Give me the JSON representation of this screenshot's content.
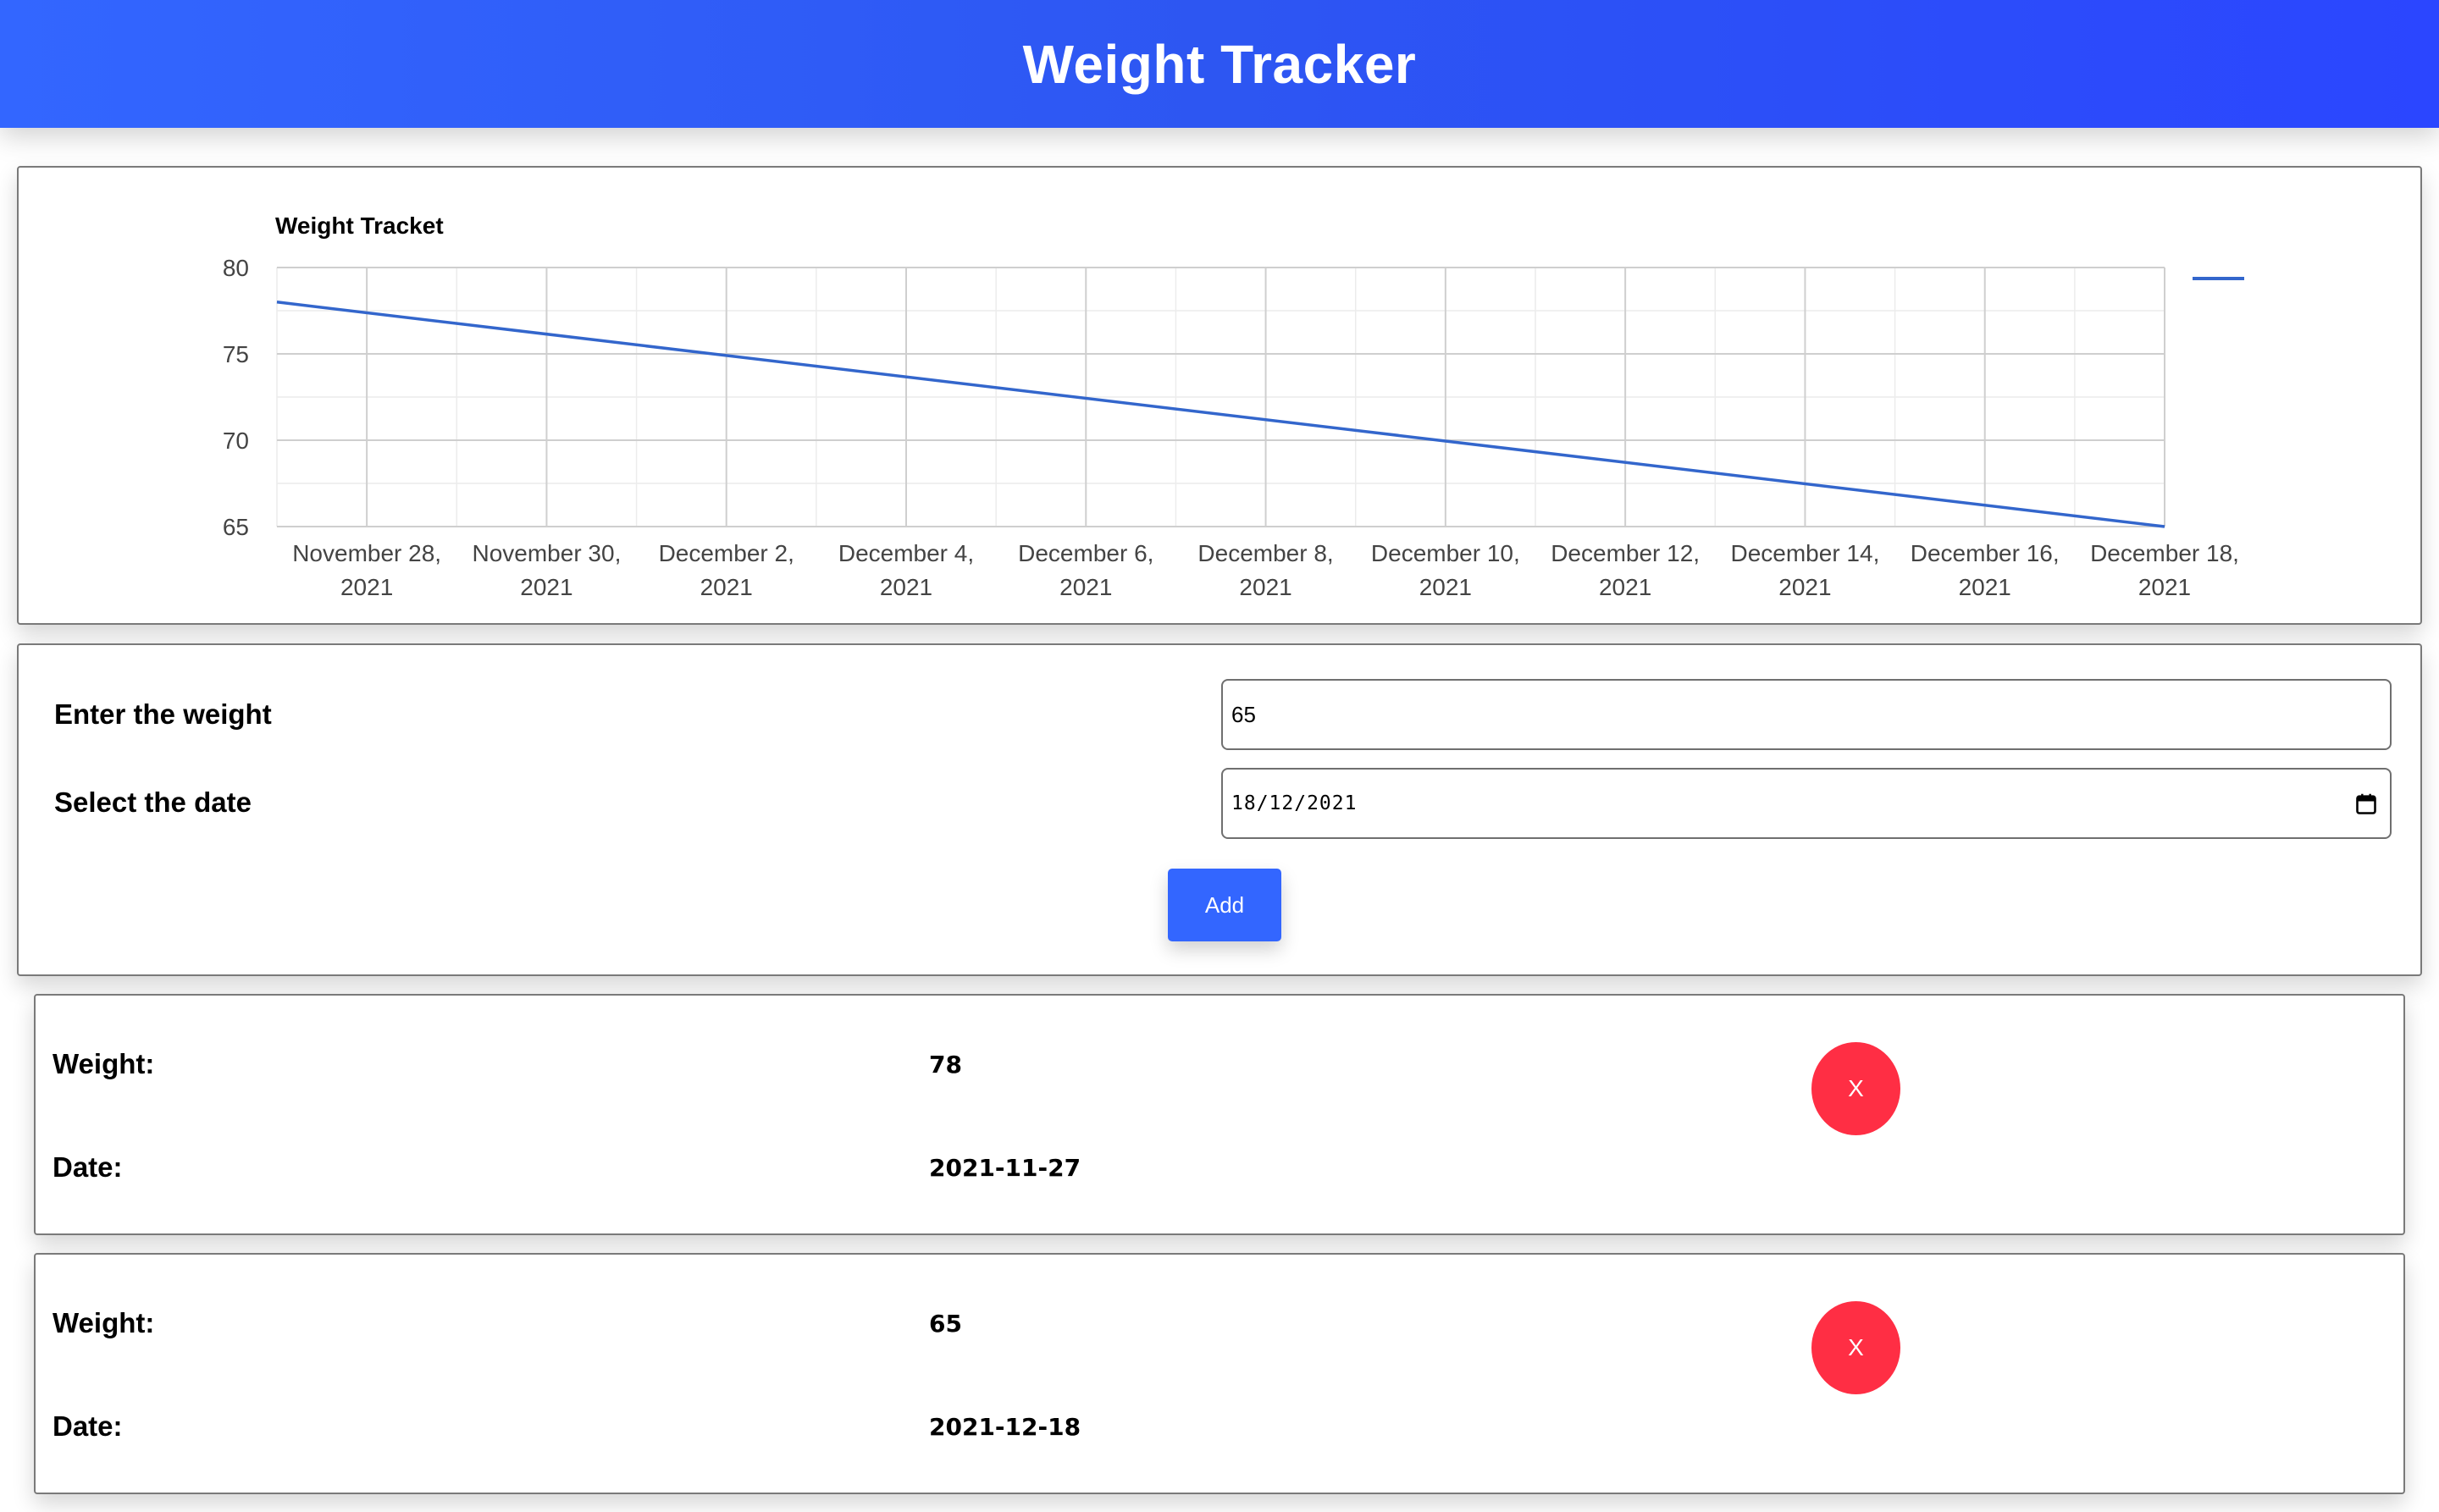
{
  "header": {
    "title": "Weight Tracker"
  },
  "chart_data": {
    "type": "line",
    "title": "Weight Tracket",
    "x": [
      "2021-11-27",
      "2021-12-18"
    ],
    "series": [
      {
        "values": [
          78,
          65
        ],
        "color": "#3366cc"
      }
    ],
    "x_tick_labels": [
      [
        "November 28,",
        "2021"
      ],
      [
        "November 30,",
        "2021"
      ],
      [
        "December 2,",
        "2021"
      ],
      [
        "December 4,",
        "2021"
      ],
      [
        "December 6,",
        "2021"
      ],
      [
        "December 8,",
        "2021"
      ],
      [
        "December 10,",
        "2021"
      ],
      [
        "December 12,",
        "2021"
      ],
      [
        "December 14,",
        "2021"
      ],
      [
        "December 16,",
        "2021"
      ],
      [
        "December 18,",
        "2021"
      ]
    ],
    "y_ticks": [
      65,
      70,
      75,
      80
    ],
    "xlim": [
      "2021-11-27",
      "2021-12-18"
    ],
    "ylim": [
      65,
      80
    ],
    "grid": true,
    "legend": "right"
  },
  "form": {
    "weight_label": "Enter the weight",
    "weight_value": "65",
    "date_label": "Select the date",
    "date_value": "18/12/2021",
    "add_label": "Add"
  },
  "entries": [
    {
      "weight_label": "Weight:",
      "weight": "78",
      "date_label": "Date:",
      "date": "2021-11-27",
      "delete_label": "X"
    },
    {
      "weight_label": "Weight:",
      "weight": "65",
      "date_label": "Date:",
      "date": "2021-12-18",
      "delete_label": "X"
    }
  ],
  "colors": {
    "header": "#3366ff",
    "button": "#3366ff",
    "delete": "#ff2e44",
    "line": "#3366cc"
  }
}
